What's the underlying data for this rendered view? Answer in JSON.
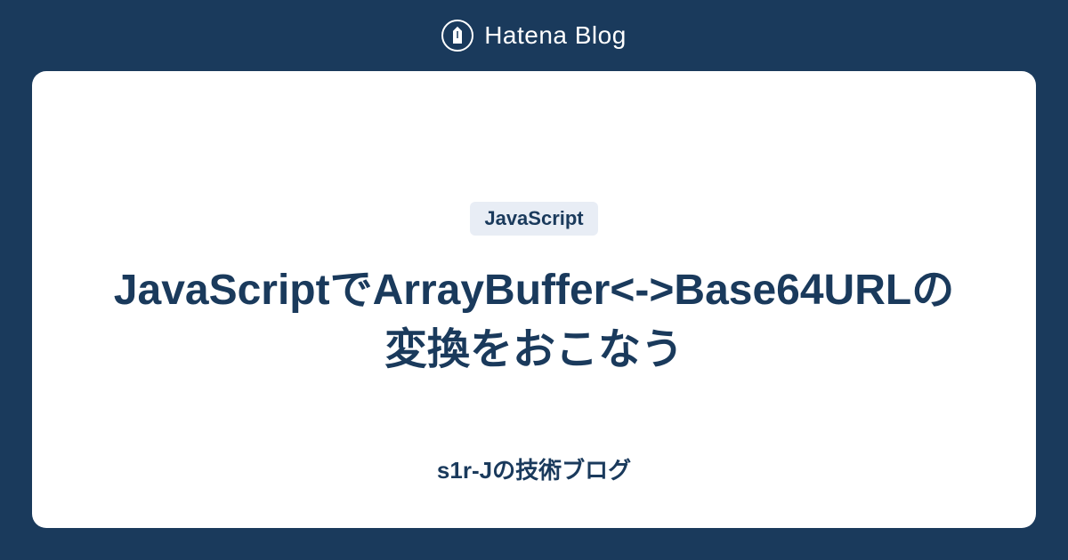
{
  "header": {
    "brand": "Hatena Blog"
  },
  "card": {
    "tag": "JavaScript",
    "title": "JavaScriptでArrayBuffer<->Base64URLの変換をおこなう",
    "author": "s1r-Jの技術ブログ"
  },
  "colors": {
    "background": "#1a3a5c",
    "card_bg": "#ffffff",
    "tag_bg": "#e8edf5",
    "text": "#1a3a5c"
  }
}
